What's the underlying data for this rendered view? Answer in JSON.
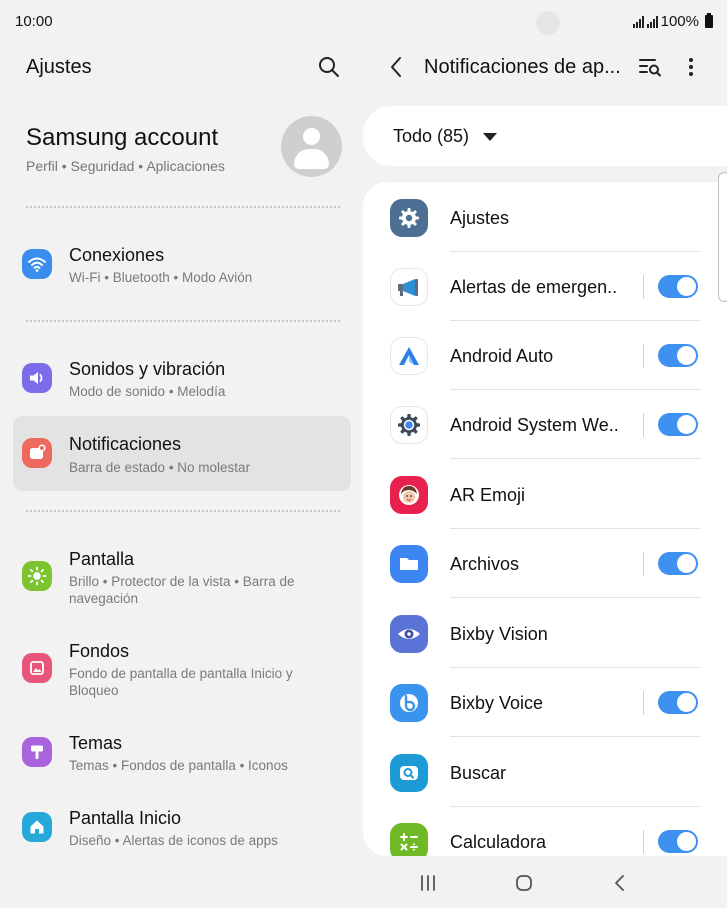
{
  "status": {
    "time": "10:00",
    "battery": "100%"
  },
  "left": {
    "title": "Ajustes",
    "account": {
      "name": "Samsung account",
      "sub": "Perfil • Seguridad • Aplicaciones"
    },
    "items": [
      {
        "title": "Conexiones",
        "sub": "Wi-Fi • Bluetooth • Modo Avión",
        "icon": "wifi-icon",
        "color": "#3a8dec"
      },
      {
        "title": "Sonidos y vibración",
        "sub": "Modo de sonido • Melodía",
        "icon": "volume-icon",
        "color": "#7b6de9"
      },
      {
        "title": "Notificaciones",
        "sub": "Barra de estado • No molestar",
        "icon": "notification-icon",
        "color": "#ef6a5e"
      },
      {
        "title": "Pantalla",
        "sub": "Brillo • Protector de la vista • Barra de navegación",
        "icon": "brightness-icon",
        "color": "#7dc431"
      },
      {
        "title": "Fondos",
        "sub": "Fondo de pantalla de pantalla Inicio y Bloqueo",
        "icon": "wallpaper-icon",
        "color": "#e9557a"
      },
      {
        "title": "Temas",
        "sub": "Temas • Fondos de pantalla • Iconos",
        "icon": "themes-icon",
        "color": "#a863dd"
      },
      {
        "title": "Pantalla Inicio",
        "sub": "Diseño • Alertas de iconos de apps",
        "icon": "home-icon",
        "color": "#25a9d8"
      }
    ]
  },
  "right": {
    "title": "Notificaciones de ap...",
    "filter": "Todo (85)",
    "apps": [
      {
        "name": "Ajustes",
        "icon": "settings-gear-icon",
        "toggle": false
      },
      {
        "name": "Alertas de emergen..",
        "icon": "megaphone-icon",
        "toggle": true
      },
      {
        "name": "Android Auto",
        "icon": "android-auto-icon",
        "toggle": true
      },
      {
        "name": "Android System We..",
        "icon": "webview-gear-icon",
        "toggle": true
      },
      {
        "name": "AR Emoji",
        "icon": "ar-emoji-icon",
        "toggle": false
      },
      {
        "name": "Archivos",
        "icon": "folder-icon",
        "toggle": true
      },
      {
        "name": "Bixby Vision",
        "icon": "eye-icon",
        "toggle": false
      },
      {
        "name": "Bixby Voice",
        "icon": "bixby-icon",
        "toggle": true
      },
      {
        "name": "Buscar",
        "icon": "finder-icon",
        "toggle": false
      },
      {
        "name": "Calculadora",
        "icon": "calculator-icon",
        "toggle": true
      }
    ]
  },
  "colors": {
    "accent": "#3e91f0",
    "active_row": "#e3e3e3"
  }
}
